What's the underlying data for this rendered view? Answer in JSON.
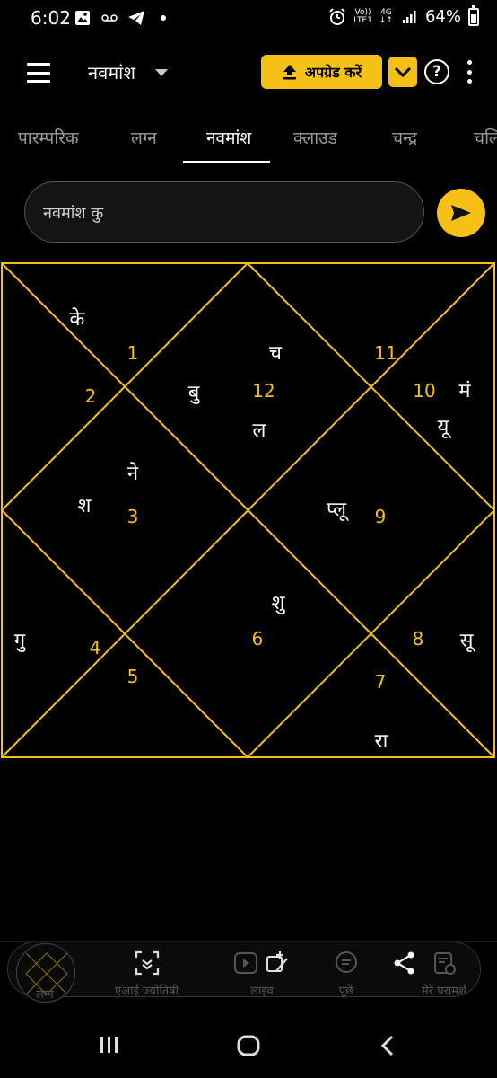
{
  "status_bar": {
    "time": "6:02",
    "network_top": "Vo))",
    "network_bottom": "LTE1",
    "gen_top": "4G",
    "gen_bottom": "↓↑",
    "battery": "64%"
  },
  "app_bar": {
    "view_title": "नवमांश",
    "upgrade_label": "अपग्रेड करें",
    "help_label": "?"
  },
  "tabs": [
    {
      "label": "पारम्परिक"
    },
    {
      "label": "लग्न"
    },
    {
      "label": "नवमांश"
    },
    {
      "label": "क्लाउड"
    },
    {
      "label": "चन्द्र"
    },
    {
      "label": "चलि"
    }
  ],
  "search": {
    "value": "नवमांश कु",
    "placeholder": ""
  },
  "chart": {
    "line_color": "#f5c116",
    "house_numbers": [
      "1",
      "2",
      "3",
      "4",
      "5",
      "6",
      "7",
      "8",
      "9",
      "10",
      "11",
      "12"
    ],
    "planets": {
      "h1": "के",
      "h2": "",
      "h3_a": "ने",
      "h3_b": "श",
      "h4": "गु",
      "h6": "शु",
      "h7": "रा",
      "h8": "सू",
      "h9": "प्लू",
      "h10_a": "मं",
      "h10_b": "यू",
      "h11": "च",
      "h12_a": "बु",
      "h12_b": "ल"
    }
  },
  "bottom_nav": [
    {
      "label": "लग्न",
      "icon": "chart-thumbnail-icon"
    },
    {
      "label": "एआई ज्योतिषी",
      "icon": "ai-scan-icon"
    },
    {
      "label": "लाइव",
      "icon": "live-video-icon"
    },
    {
      "label": "पूछें",
      "icon": "chat-bubble-icon"
    },
    {
      "label": "मेरे परामर्श",
      "icon": "consultation-icon"
    }
  ],
  "colors": {
    "accent": "#f5c116",
    "background": "#000000"
  }
}
